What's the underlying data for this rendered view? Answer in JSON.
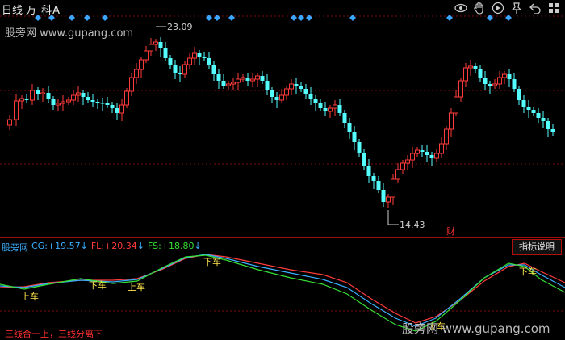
{
  "header": {
    "period": "日线",
    "stock_name": "万 科A",
    "tools": [
      "eye-icon",
      "hand-icon",
      "play-icon",
      "pin-icon",
      "back-icon",
      "grid-icon"
    ]
  },
  "watermark": "股旁网 www.gupang.com",
  "price_chart": {
    "high_label": "23.09",
    "low_label": "14.43",
    "marker": "财",
    "colors": {
      "up": "#ff3b3b",
      "down": "#54ffff",
      "diamond": "#3aa6ff",
      "grid": "#7a0a0a"
    }
  },
  "indicator": {
    "name": "股旁网",
    "cg_label": "CG:",
    "cg_value": "+19.57",
    "fl_label": "FL:",
    "fl_value": "+20.34",
    "fs_label": "FS:",
    "fs_value": "+18.80",
    "arrow": "↓",
    "explain_button": "指标说明",
    "footnote": "三线合一上，三线分离下",
    "signals": [
      "上车",
      "下车",
      "上车",
      "下车",
      "上车",
      "下车"
    ],
    "colors": {
      "cg": "#3ab0ff",
      "fl": "#ff3b3b",
      "fs": "#35e035"
    }
  }
}
